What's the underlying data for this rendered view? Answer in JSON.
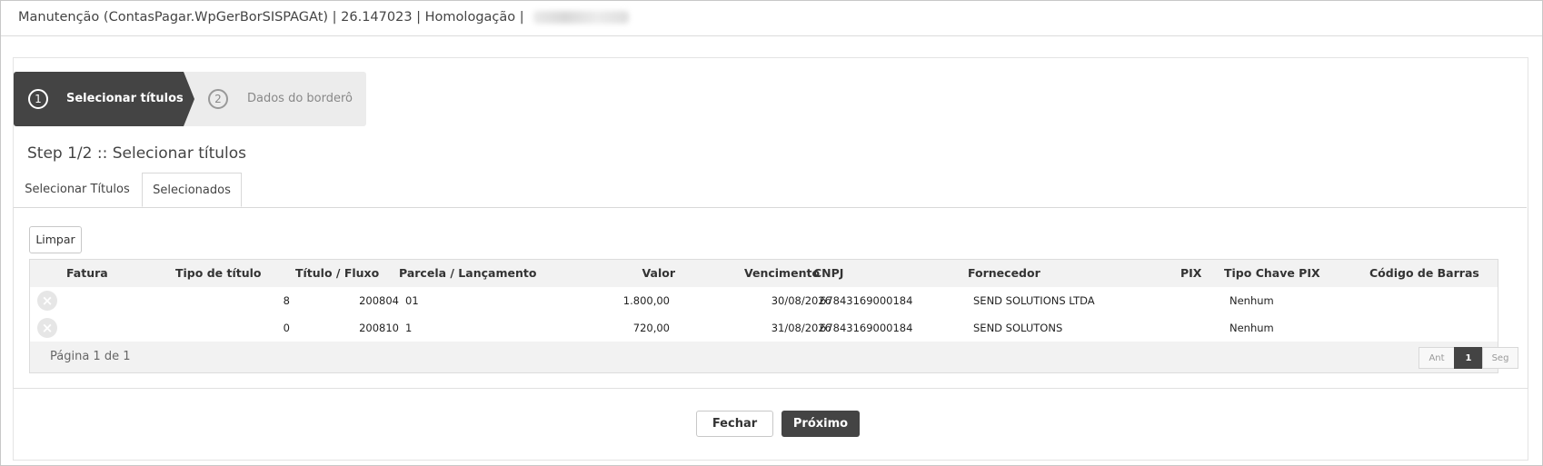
{
  "window": {
    "title": "Manutenção (ContasPagar.WpGerBorSISPAGAt) | 26.147023 | Homologação |"
  },
  "wizard": {
    "steps": [
      {
        "number": "1",
        "label": "Selecionar títulos",
        "active": true
      },
      {
        "number": "2",
        "label": "Dados do borderô",
        "active": false
      }
    ],
    "heading": "Step 1/2 :: Selecionar títulos"
  },
  "tabs": [
    {
      "label": "Selecionar Títulos",
      "active": false
    },
    {
      "label": "Selecionados",
      "active": true
    }
  ],
  "toolbar": {
    "clear_label": "Limpar"
  },
  "grid": {
    "columns": {
      "fatura": "Fatura",
      "tipo": "Tipo de título",
      "titulo": "Título / Fluxo",
      "parcela": "Parcela / Lançamento",
      "valor": "Valor",
      "vencimento": "Vencimento",
      "cnpj": "CNPJ",
      "fornecedor": "Fornecedor",
      "pix": "PIX",
      "tipo_chave": "Tipo Chave PIX",
      "codigo_barras": "Código de Barras"
    },
    "rows": [
      {
        "tipo": "8",
        "titulo": "200804",
        "parcela": "01",
        "valor": "1.800,00",
        "vencimento": "30/08/2026",
        "cnpj": "67843169000184",
        "fornecedor": "SEND SOLUTIONS LTDA",
        "tipo_chave": "Nenhum"
      },
      {
        "tipo": "0",
        "titulo": "200810",
        "parcela": "1",
        "valor": "720,00",
        "vencimento": "31/08/2026",
        "cnpj": "67843169000184",
        "fornecedor": "SEND SOLUTONS",
        "tipo_chave": "Nenhum"
      }
    ],
    "remove_icon": "×",
    "pager": {
      "info": "Página 1 de 1",
      "prev": "Ant",
      "current": "1",
      "next": "Seg"
    }
  },
  "footer": {
    "close_label": "Fechar",
    "next_label": "Próximo"
  },
  "colors": {
    "dark": "#444444",
    "muted": "#ececec"
  }
}
